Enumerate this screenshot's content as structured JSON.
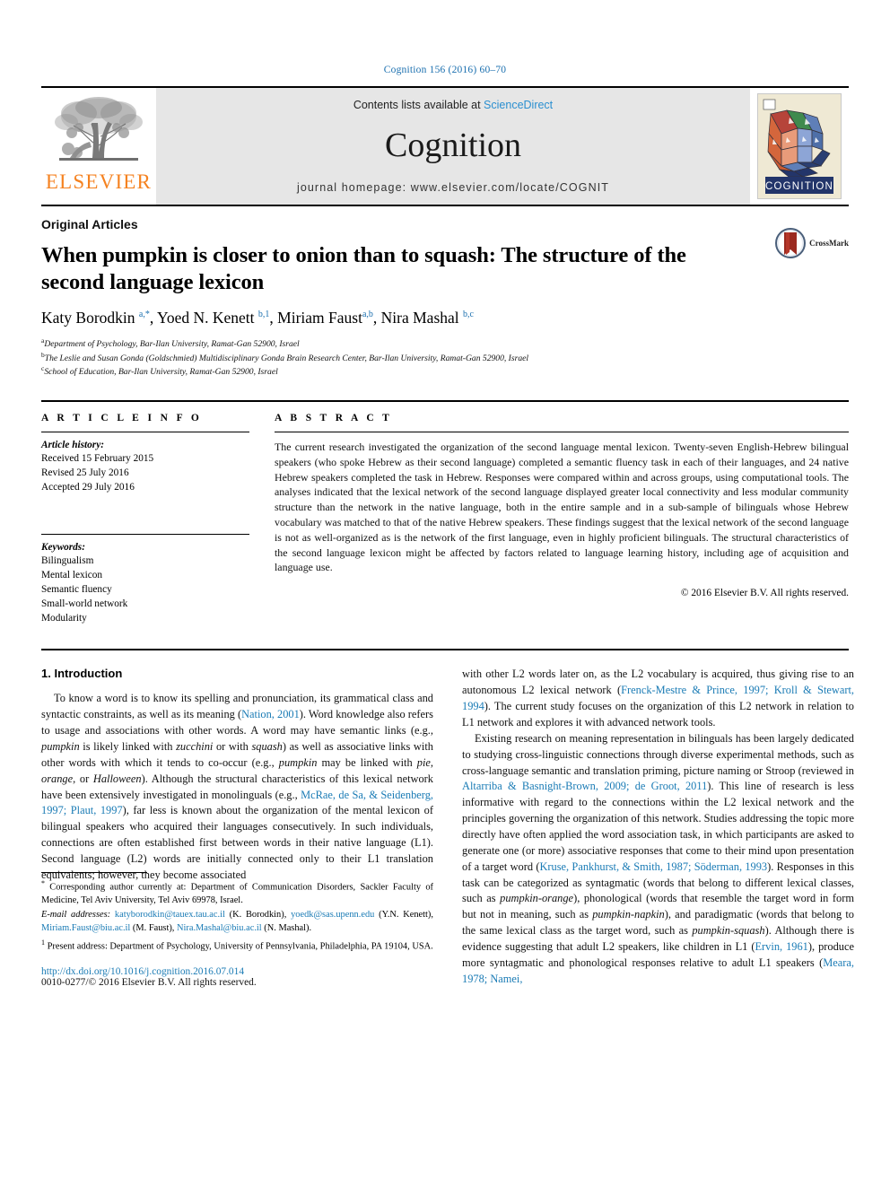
{
  "running_head": "Cognition 156 (2016) 60–70",
  "masthead": {
    "publisher_logo_label": "ELSEVIER",
    "contents_prefix": "Contents lists available at ",
    "contents_link": "ScienceDirect",
    "journal_name": "Cognition",
    "homepage_line": "journal homepage: www.elsevier.com/locate/COGNIT",
    "cover_caption": "COGNITION"
  },
  "article": {
    "kicker": "Original Articles",
    "title": "When pumpkin is closer to onion than to squash: The structure of the second language lexicon",
    "crossmark_label": "CrossMark",
    "authors_html": "Katy Borodkin <sup>a,*</sup>, Yoed N. Kenett <sup>b,1</sup>, Miriam Faust<sup>a,b</sup>, Nira Mashal <sup>b,c</sup>",
    "affiliations": [
      "Department of Psychology, Bar-Ilan University, Ramat-Gan 52900, Israel",
      "The Leslie and Susan Gonda (Goldschmied) Multidisciplinary Gonda Brain Research Center, Bar-Ilan University, Ramat-Gan 52900, Israel",
      "School of Education, Bar-Ilan University, Ramat-Gan 52900, Israel"
    ],
    "affiliation_marks": [
      "a",
      "b",
      "c"
    ]
  },
  "article_info": {
    "heading": "A R T I C L E  I N F O",
    "history_label": "Article history:",
    "history": [
      "Received 15 February 2015",
      "Revised 25 July 2016",
      "Accepted 29 July 2016"
    ],
    "keywords_label": "Keywords:",
    "keywords": [
      "Bilingualism",
      "Mental lexicon",
      "Semantic fluency",
      "Small-world network",
      "Modularity"
    ]
  },
  "abstract": {
    "heading": "A B S T R A C T",
    "text": "The current research investigated the organization of the second language mental lexicon. Twenty-seven English-Hebrew bilingual speakers (who spoke Hebrew as their second language) completed a semantic fluency task in each of their languages, and 24 native Hebrew speakers completed the task in Hebrew. Responses were compared within and across groups, using computational tools. The analyses indicated that the lexical network of the second language displayed greater local connectivity and less modular community structure than the network in the native language, both in the entire sample and in a sub-sample of bilinguals whose Hebrew vocabulary was matched to that of the native Hebrew speakers. These findings suggest that the lexical network of the second language is not as well-organized as is the network of the first language, even in highly proficient bilinguals. The structural characteristics of the second language lexicon might be affected by factors related to language learning history, including age of acquisition and language use.",
    "copyright": "© 2016 Elsevier B.V. All rights reserved."
  },
  "body": {
    "section_title": "1. Introduction",
    "left_paragraph_1_html": "To know a word is to know its spelling and pronunciation, its grammatical class and syntactic constraints, as well as its meaning (<span class=\"cite\">Nation, 2001</span>). Word knowledge also refers to usage and associations with other words. A word may have semantic links (e.g., <em>pumpkin</em> is likely linked with <em>zucchini</em> or with <em>squash</em>) as well as associative links with other words with which it tends to co-occur (e.g., <em>pumpkin</em> may be linked with <em>pie</em>, <em>orange</em>, or <em>Halloween</em>). Although the structural characteristics of this lexical network have been extensively investigated in monolinguals (e.g., <span class=\"cite\">McRae, de Sa, &amp; Seidenberg, 1997; Plaut, 1997</span>), far less is known about the organization of the mental lexicon of bilingual speakers who acquired their languages consecutively. In such individuals, connections are often established first between words in their native language (L1). Second language (L2) words are initially connected only to their L1 translation equivalents; however, they become associated",
    "right_paragraph_1_html": "with other L2 words later on, as the L2 vocabulary is acquired, thus giving rise to an autonomous L2 lexical network (<span class=\"cite\">Frenck-Mestre &amp; Prince, 1997; Kroll &amp; Stewart, 1994</span>). The current study focuses on the organization of this L2 network in relation to L1 network and explores it with advanced network tools.",
    "right_paragraph_2_html": "Existing research on meaning representation in bilinguals has been largely dedicated to studying cross-linguistic connections through diverse experimental methods, such as cross-language semantic and translation priming, picture naming or Stroop (reviewed in <span class=\"cite\">Altarriba &amp; Basnight-Brown, 2009; de Groot, 2011</span>). This line of research is less informative with regard to the connections within the L2 lexical network and the principles governing the organization of this network. Studies addressing the topic more directly have often applied the word association task, in which participants are asked to generate one (or more) associative responses that come to their mind upon presentation of a target word (<span class=\"cite\">Kruse, Pankhurst, &amp; Smith, 1987; Söderman, 1993</span>). Responses in this task can be categorized as syntagmatic (words that belong to different lexical classes, such as <em>pumpkin-orange</em>), phonological (words that resemble the target word in form but not in meaning, such as <em>pumpkin-napkin</em>), and paradigmatic (words that belong to the same lexical class as the target word, such as <em>pumpkin-squash</em>). Although there is evidence suggesting that adult L2 speakers, like children in L1 (<span class=\"cite\">Ervin, 1961</span>), produce more syntagmatic and phonological responses relative to adult L1 speakers (<span class=\"cite\">Meara, 1978; Namei,</span>"
  },
  "footnotes": {
    "corresponding_html": "<sup>*</sup> Corresponding author currently at: Department of Communication Disorders, Sackler Faculty of Medicine, Tel Aviv University, Tel Aviv 69978, Israel.",
    "emails_html": "<span class=\"ital\">E-mail addresses:</span> <span class=\"lnk\">katyborodkin@tauex.tau.ac.il</span> (K. Borodkin), <span class=\"lnk\">yoedk@sas.upenn.edu</span> (Y.N. Kenett), <span class=\"lnk\">Miriam.Faust@biu.ac.il</span> (M. Faust), <span class=\"lnk\">Nira.Mashal@biu.ac.il</span> (N. Mashal).",
    "present_address_html": "<sup>1</sup> Present address: Department of Psychology, University of Pennsylvania, Philadelphia, PA 19104, USA.",
    "doi": "http://dx.doi.org/10.1016/j.cognition.2016.07.014",
    "issn_line": "0010-0277/© 2016 Elsevier B.V. All rights reserved."
  },
  "colors": {
    "link_blue": "#1a7bb5",
    "running_head_blue": "#1a6faf",
    "elsevier_orange": "#F58220",
    "band_gray": "#e6e6e6",
    "cover_cream": "#efe9d4",
    "cover_navy": "#263a66"
  }
}
